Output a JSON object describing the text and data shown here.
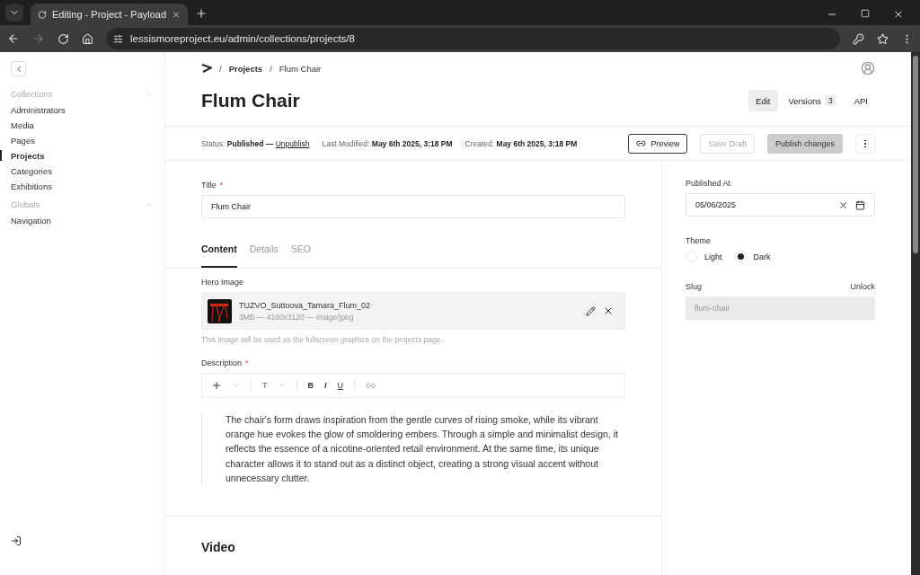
{
  "browser": {
    "tab_title": "Editing - Project - Payload",
    "url": "lessismoreproject.eu/admin/collections/projects/8"
  },
  "sidebar": {
    "groups": [
      {
        "label": "Collections",
        "expanded": true,
        "items": [
          {
            "label": "Administrators",
            "selected": false
          },
          {
            "label": "Media",
            "selected": false
          },
          {
            "label": "Pages",
            "selected": false
          },
          {
            "label": "Projects",
            "selected": true
          },
          {
            "label": "Categories",
            "selected": false
          },
          {
            "label": "Exhibitions",
            "selected": false
          }
        ]
      },
      {
        "label": "Globals",
        "expanded": true,
        "items": [
          {
            "label": "Navigation",
            "selected": false
          }
        ]
      }
    ]
  },
  "breadcrumb_separator": "/",
  "breadcrumb": [
    "Projects",
    "Flum Chair"
  ],
  "required_mark": "*",
  "title": "Flum Chair",
  "view_tabs": [
    {
      "label": "Edit",
      "selected": true
    },
    {
      "label": "Versions",
      "selected": false,
      "count": "3"
    },
    {
      "label": "API",
      "selected": false
    }
  ],
  "status": {
    "status_label": "Status:",
    "status_value": "Published —",
    "unpublish": "Unpublish",
    "modified_label": "Last Modified:",
    "modified_value": "May 6th 2025, 3:18 PM",
    "created_label": "Created:",
    "created_value": "May 6th 2025, 3:18 PM"
  },
  "actions": [
    {
      "label": "Preview",
      "kind": "outline",
      "disabled": false
    },
    {
      "label": "Save Draft",
      "kind": "outline",
      "disabled": true
    },
    {
      "label": "Publish changes",
      "kind": "filled",
      "disabled": true
    }
  ],
  "title_field": {
    "label": "Title",
    "required": true,
    "value": "Flum Chair"
  },
  "content_tabs": [
    {
      "label": "Content",
      "selected": true
    },
    {
      "label": "Details",
      "selected": false
    },
    {
      "label": "SEO",
      "selected": false
    }
  ],
  "hero": {
    "label": "Hero Image",
    "filename": "TUZVO_Suttoova_Tamara_Flum_02",
    "meta": "3MB — 4160x3120 — image/jpeg",
    "help": "This image will be used as the fullscreen graphics on the projects page."
  },
  "description": {
    "label": "Description",
    "required": true,
    "text": "The chair's form draws inspiration from the gentle curves of rising smoke, while its vibrant orange hue evokes the glow of smoldering embers. Through a simple and minimalist design, it reflects the essence of a nicotine-oriented retail environment. At the same time, its unique character allows it to stand out as a distinct object, creating a strong visual accent without unnecessary clutter."
  },
  "toolbar": {
    "format": "T",
    "bold": "B",
    "italic": "I",
    "underline": "U"
  },
  "video_heading": "Video",
  "published_at": {
    "label": "Published At",
    "value": "05/06/2025"
  },
  "theme": {
    "label": "Theme",
    "options": [
      {
        "label": "Light",
        "selected": false
      },
      {
        "label": "Dark",
        "selected": true
      }
    ]
  },
  "slug": {
    "label": "Slug",
    "action": "Unlock",
    "value": "flum-chair"
  }
}
